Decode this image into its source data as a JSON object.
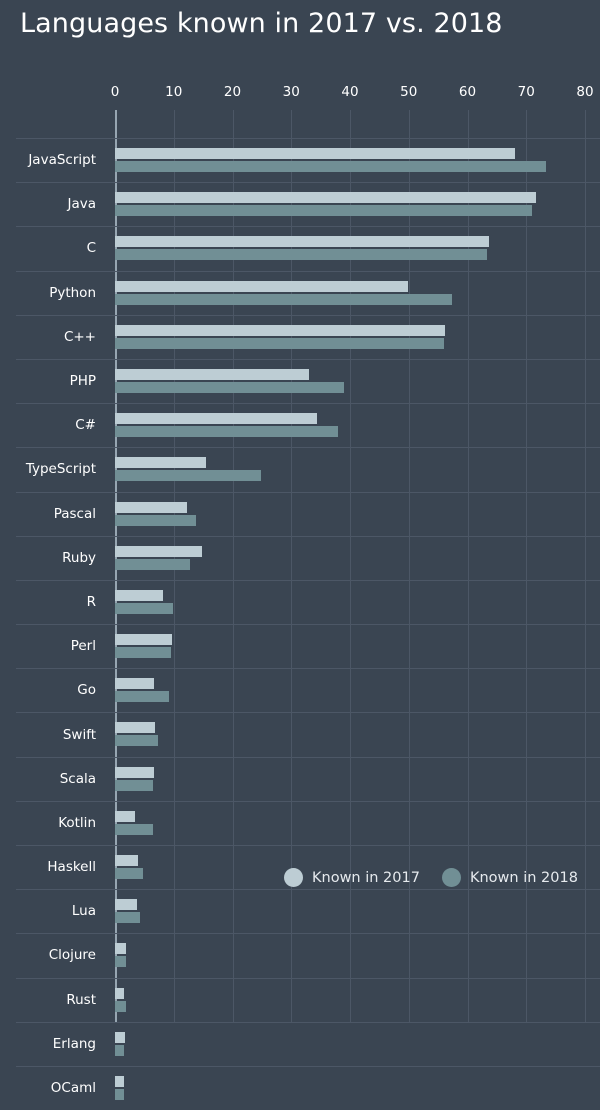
{
  "chart_data": {
    "type": "bar",
    "orientation": "horizontal",
    "grouped": true,
    "title": "Languages known in 2017 vs. 2018",
    "xlabel": "",
    "ylabel": "",
    "xlim": [
      0,
      80
    ],
    "xticks": [
      0,
      10,
      20,
      30,
      40,
      50,
      60,
      70,
      80
    ],
    "xtick_labels": [
      "0",
      "10",
      "20",
      "30",
      "40",
      "50",
      "60",
      "70",
      "80"
    ],
    "grid": "vertical",
    "legend_position": "bottom-right",
    "categories": [
      "JavaScript",
      "Java",
      "C",
      "Python",
      "C++",
      "PHP",
      "C#",
      "TypeScript",
      "Pascal",
      "Ruby",
      "R",
      "Perl",
      "Go",
      "Swift",
      "Scala",
      "Kotlin",
      "Haskell",
      "Lua",
      "Clojure",
      "Rust",
      "Erlang",
      "OCaml"
    ],
    "series": [
      {
        "name": "Known in 2017",
        "color": "#bdcdd4",
        "values": [
          68.0,
          71.7,
          63.7,
          49.9,
          56.2,
          33.0,
          34.4,
          15.5,
          12.3,
          14.8,
          8.2,
          9.7,
          6.6,
          6.8,
          6.6,
          3.4,
          3.9,
          3.8,
          1.9,
          1.5,
          1.7,
          1.5
        ]
      },
      {
        "name": "Known in 2018",
        "color": "#718f95",
        "values": [
          73.4,
          71.0,
          63.3,
          57.4,
          56.0,
          39.0,
          38.0,
          24.9,
          13.8,
          12.8,
          9.9,
          9.5,
          9.2,
          7.3,
          6.5,
          6.4,
          4.8,
          4.3,
          1.9,
          1.9,
          1.6,
          1.5
        ]
      }
    ]
  },
  "theme": {
    "background": "#3a4552",
    "gridline": "#4c5766",
    "axis_line": "#97a6b2",
    "text": "#ffffff"
  }
}
